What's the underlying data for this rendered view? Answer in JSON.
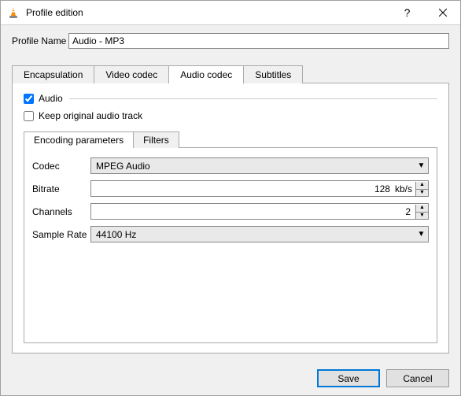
{
  "window": {
    "title": "Profile edition"
  },
  "profile": {
    "name_label": "Profile Name",
    "name_value": "Audio - MP3"
  },
  "tabs": {
    "encapsulation": "Encapsulation",
    "video_codec": "Video codec",
    "audio_codec": "Audio codec",
    "subtitles": "Subtitles"
  },
  "audio_tab": {
    "audio_label": "Audio",
    "audio_checked": true,
    "keep_original_label": "Keep original audio track",
    "keep_original_checked": false,
    "subtabs": {
      "encoding": "Encoding parameters",
      "filters": "Filters"
    },
    "fields": {
      "codec_label": "Codec",
      "codec_value": "MPEG Audio",
      "bitrate_label": "Bitrate",
      "bitrate_value": "128",
      "bitrate_unit": "kb/s",
      "channels_label": "Channels",
      "channels_value": "2",
      "samplerate_label": "Sample Rate",
      "samplerate_value": "44100 Hz"
    }
  },
  "buttons": {
    "save": "Save",
    "cancel": "Cancel"
  }
}
